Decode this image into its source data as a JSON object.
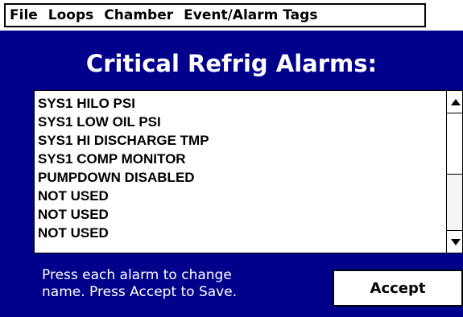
{
  "menu": {
    "items": [
      {
        "label": "File"
      },
      {
        "label": "Loops"
      },
      {
        "label": "Chamber"
      },
      {
        "label": "Event/Alarm Tags"
      }
    ]
  },
  "title": "Critical Refrig Alarms:",
  "alarm_list": {
    "items": [
      "SYS1 HILO PSI",
      "SYS1 LOW OIL PSI",
      "SYS1 HI DISCHARGE TMP",
      "SYS1 COMP MONITOR",
      "PUMPDOWN DISABLED",
      "NOT USED",
      "NOT USED",
      "NOT USED"
    ],
    "scroll_up_icon": "triangle-up",
    "scroll_down_icon": "triangle-down"
  },
  "instructions": {
    "line1": "Press each alarm to change",
    "line2": "name. Press Accept to Save."
  },
  "accept_label": "Accept",
  "colors": {
    "panel": "#00008b",
    "text_on_panel": "#ffffff",
    "list_background": "#ffffff"
  }
}
